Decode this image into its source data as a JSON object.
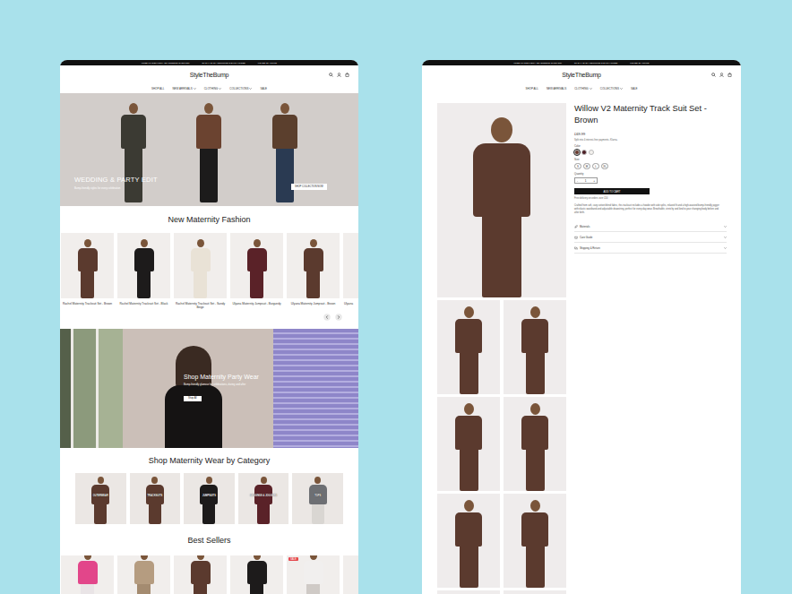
{
  "left_page": {
    "announcement": [
      "FREE UK DELIVERY ON ORDERS OVER £50",
      "30 DAY EASY RETURNS & EXCHANGES",
      "LOVED BY MUMS"
    ],
    "logo": "StyleTheBump",
    "nav": [
      {
        "label": "SHOP ALL",
        "has_menu": false
      },
      {
        "label": "NEW ARRIVALS",
        "has_menu": true
      },
      {
        "label": "CLOTHING",
        "has_menu": true
      },
      {
        "label": "COLLECTIONS",
        "has_menu": true
      },
      {
        "label": "SALE",
        "has_menu": false
      }
    ],
    "hero": {
      "title": "WEDDING & PARTY EDIT",
      "subtitle": "Bump-friendly styles for every celebration",
      "button": "SHOP COLLECTION NOW"
    },
    "new_fashion": {
      "heading": "New Maternity Fashion",
      "products": [
        "Rachel Maternity Tracksuit Set - Brown",
        "Rachel Maternity Tracksuit Set - Black",
        "Rachel Maternity Tracksuit Set - Sandy Beige",
        "Ulyana Maternity Jumpsuit - Burgundy",
        "Ulyana Maternity Jumpsuit - Brown",
        "Ulyana"
      ]
    },
    "party_banner": {
      "title": "Shop Maternity Party Wear",
      "subtitle": "Bump-friendly glamour for celebrations, during and after",
      "button": "Shop All"
    },
    "categories": {
      "heading": "Shop Maternity Wear by Category",
      "items": [
        "OUTERWEAR",
        "TRACKSUITS",
        "JUMPSUITS",
        "LEGGINGS & JOGGERS",
        "TOPS"
      ]
    },
    "best_sellers": {
      "heading": "Best Sellers",
      "badge": "SALE",
      "products": [
        {
          "on_sale": false
        },
        {
          "on_sale": false
        },
        {
          "on_sale": false
        },
        {
          "on_sale": false
        },
        {
          "on_sale": true
        },
        {
          "on_sale": false
        }
      ]
    }
  },
  "right_page": {
    "announcement": [
      "FREE UK DELIVERY ON ORDERS OVER £50",
      "30 DAY EASY RETURNS & EXCHANGES",
      "LOVED BY MUMS"
    ],
    "logo": "StyleTheBump",
    "nav": [
      {
        "label": "SHOP ALL",
        "has_menu": false
      },
      {
        "label": "NEW ARRIVALS",
        "has_menu": false
      },
      {
        "label": "CLOTHING",
        "has_menu": true
      },
      {
        "label": "COLLECTIONS",
        "has_menu": true
      },
      {
        "label": "SALE",
        "has_menu": false
      }
    ],
    "product": {
      "title": "Willow V2 Maternity Track Suit Set - Brown",
      "price": "£69.99",
      "installments": "Split into 4 interest-free payments. Klarna.",
      "color_label": "Color",
      "colors": [
        {
          "color": "#6a3a2e",
          "selected": true
        },
        {
          "color": "#4b1c22",
          "selected": false
        },
        {
          "color": "#f4f1ee",
          "selected": false
        }
      ],
      "size_label": "Size",
      "sizes": [
        {
          "label": "S",
          "selected": false
        },
        {
          "label": "M",
          "selected": false
        },
        {
          "label": "L",
          "selected": false
        },
        {
          "label": "XL",
          "selected": false
        }
      ],
      "quantity_label": "Quantity",
      "minus": "-",
      "quantity": "1",
      "plus": "+",
      "add_to_cart": "ADD TO CART",
      "shipping_note": "Free delivery on orders over £50",
      "description": "Crafted from soft, cozy cotton blend fabric, this tracksuit includes a hoodie with side splits, relaxed fit and a high-waisted bump-friendly jogger with elastic waistband and adjustable drawstring, perfect for every day wear. Breathable, stretchy and kind to your changing body before and after birth.",
      "accordions": [
        {
          "label": "Materials",
          "expanded": false
        },
        {
          "label": "Care Guide",
          "expanded": false
        },
        {
          "label": "Shipping & Return",
          "expanded": false
        }
      ]
    }
  }
}
